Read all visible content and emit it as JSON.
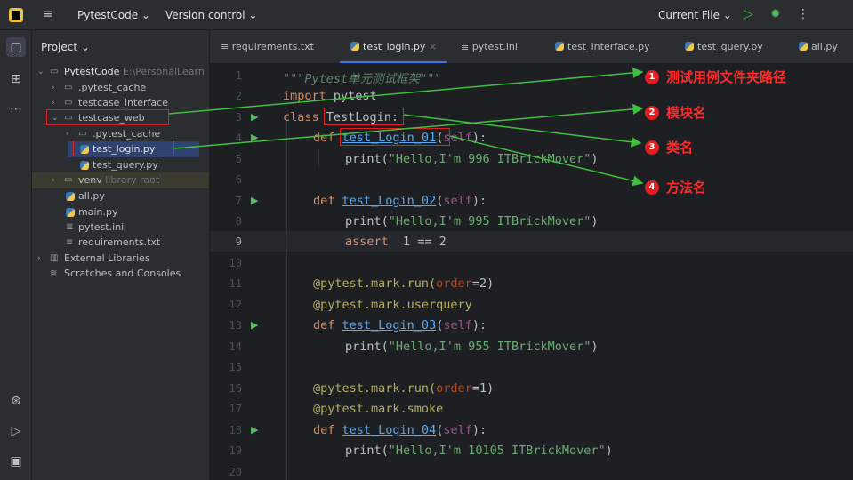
{
  "titlebar": {
    "project_name": "PytestCode ⌄",
    "version_control": "Version control ⌄",
    "current_file": "Current File ⌄",
    "run_glyph": "▷",
    "debug_glyph": "✹",
    "more_glyph": "⋮",
    "menu_glyph": "≡"
  },
  "project_panel": {
    "header": "Project ⌄",
    "tree": [
      {
        "label": "PytestCode",
        "hint": " E:\\PersonalLearn",
        "arrow": "⌄"
      },
      {
        "label": ".pytest_cache",
        "arrow": "›"
      },
      {
        "label": "testcase_interface",
        "arrow": "›"
      },
      {
        "label": "testcase_web",
        "arrow": "⌄"
      },
      {
        "label": ".pytest_cache",
        "arrow": "›"
      },
      {
        "label": "test_login.py"
      },
      {
        "label": "test_query.py"
      },
      {
        "label": "venv",
        "hint": " library root",
        "arrow": "›"
      },
      {
        "label": "all.py"
      },
      {
        "label": "main.py"
      },
      {
        "label": "pytest.ini"
      },
      {
        "label": "requirements.txt"
      },
      {
        "label": "External Libraries",
        "arrow": "›"
      },
      {
        "label": "Scratches and Consoles"
      }
    ]
  },
  "tabs": [
    {
      "label": "requirements.txt"
    },
    {
      "label": "test_login.py",
      "close": "×"
    },
    {
      "label": "pytest.ini"
    },
    {
      "label": "test_interface.py"
    },
    {
      "label": "test_query.py"
    },
    {
      "label": "all.py"
    }
  ],
  "line_numbers": [
    "1",
    "2",
    "3",
    "4",
    "5",
    "6",
    "7",
    "8",
    "9",
    "10",
    "11",
    "12",
    "13",
    "14",
    "15",
    "16",
    "17",
    "18",
    "19",
    "20"
  ],
  "code": {
    "l1": "\"\"\"Pytest单元测试框架\"\"\"",
    "l2_kw": "import",
    "l2_rest": " pytest",
    "l3_kw": "class",
    "l3_name": " TestLogin:",
    "l4_kw": "def",
    "l4_fn": "test_Login_01",
    "l4_self": "self",
    "l5_print": "print(",
    "l5_str": "\"Hello,I'm 996 ITBrickMover\"",
    "l7_fn": "test_Login_02",
    "l8_str": "\"Hello,I'm 995 ITBrickMover\"",
    "l9_kw": "assert",
    "l9_rest": "  1 == 2",
    "l11_deco": "@pytest.mark.run(",
    "l11_param": "order",
    "l11_val": "=2)",
    "l12_deco": "@pytest.mark.userquery",
    "l13_fn": "test_Login_03",
    "l14_str": "\"Hello,I'm 955 ITBrickMover\"",
    "l16_val": "=1)",
    "l17_deco": "@pytest.mark.smoke",
    "l18_fn": "test_Login_04",
    "l19_str": "\"Hello,I'm 10105 ITBrickMover\"",
    "def_kw": "def",
    "paren_open": "(",
    "paren_close": "):",
    "close_paren": ")"
  },
  "callouts": [
    {
      "num": "1",
      "text": "测试用例文件夹路径"
    },
    {
      "num": "2",
      "text": "模块名"
    },
    {
      "num": "3",
      "text": "类名"
    },
    {
      "num": "4",
      "text": "方法名"
    }
  ],
  "colors": {
    "annotation_red": "#e02020",
    "arrow_green": "#3fbf3f",
    "background": "#1e1f22",
    "panel": "#2b2d30"
  }
}
